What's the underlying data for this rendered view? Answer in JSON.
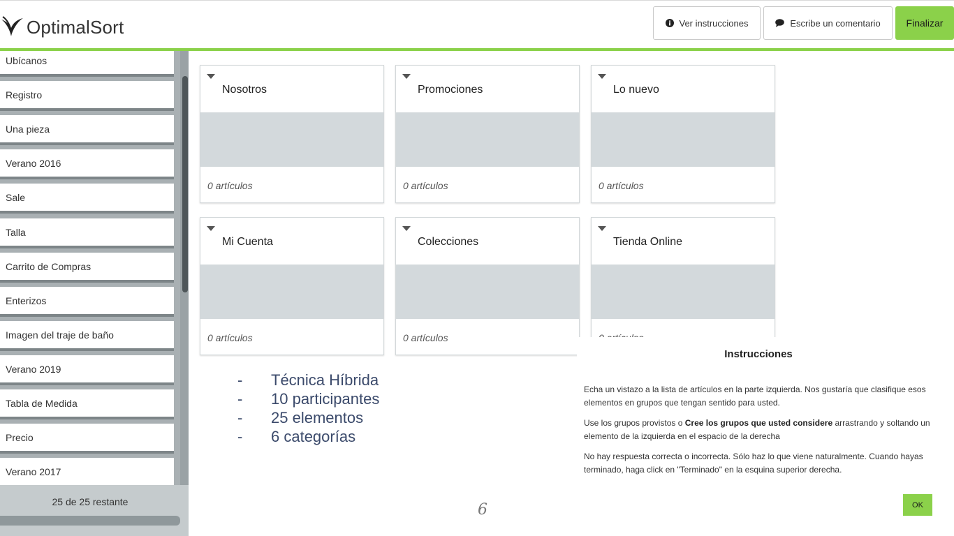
{
  "header": {
    "logo_text": "OptimalSort",
    "buttons": {
      "instructions": "Ver instrucciones",
      "comment": "Escribe un comentario",
      "finish": "Finalizar"
    }
  },
  "sidebar": {
    "items": [
      "Ubícanos",
      "Registro",
      "Una pieza",
      "Verano 2016",
      "Sale",
      "Talla",
      "Carrito de Compras",
      "Enterizos",
      "Imagen del traje de baño",
      "Verano 2019",
      "Tabla de Medida",
      "Precio",
      "Verano 2017"
    ],
    "remaining": "25 de 25 restante"
  },
  "groups": [
    {
      "title": "Nosotros",
      "count": "0 artículos"
    },
    {
      "title": "Promociones",
      "count": "0 artículos"
    },
    {
      "title": "Lo nuevo",
      "count": "0 artículos"
    },
    {
      "title": "Mi Cuenta",
      "count": "0 artículos"
    },
    {
      "title": "Colecciones",
      "count": "0 artículos"
    },
    {
      "title": "Tienda Online",
      "count": "0 artículos"
    }
  ],
  "notes": [
    {
      "dash": "-",
      "text": "Técnica Híbrida"
    },
    {
      "dash": "-",
      "text": "10 participantes"
    },
    {
      "dash": "-",
      "text": "25 elementos"
    },
    {
      "dash": "-",
      "text": "6 categorías"
    }
  ],
  "page_number": "6",
  "modal": {
    "title": "Instrucciones",
    "p1": "Echa un vistazo a la lista de artículos en la parte izquierda. Nos gustaría que clasifique esos elementos en grupos que tengan sentido para usted.",
    "p2_a": "Use los grupos provistos o ",
    "p2_b": "Cree los grupos que usted considere",
    "p2_c": " arrastrando y soltando un elemento de la izquierda en el espacio de la derecha",
    "p3": "No hay respuesta correcta o incorrecta. Sólo haz lo que viene naturalmente. Cuando hayas terminado, haga click en \"Terminado\" en la esquina superior derecha.",
    "ok": "OK"
  },
  "colors": {
    "accent_green": "#8bd14a",
    "sidebar_bg": "#a9b0b3",
    "drop_zone": "#d3d9dc"
  },
  "icons": [
    "optimalsort-logo-icon",
    "info-icon",
    "comment-icon",
    "caret-down-icon"
  ]
}
